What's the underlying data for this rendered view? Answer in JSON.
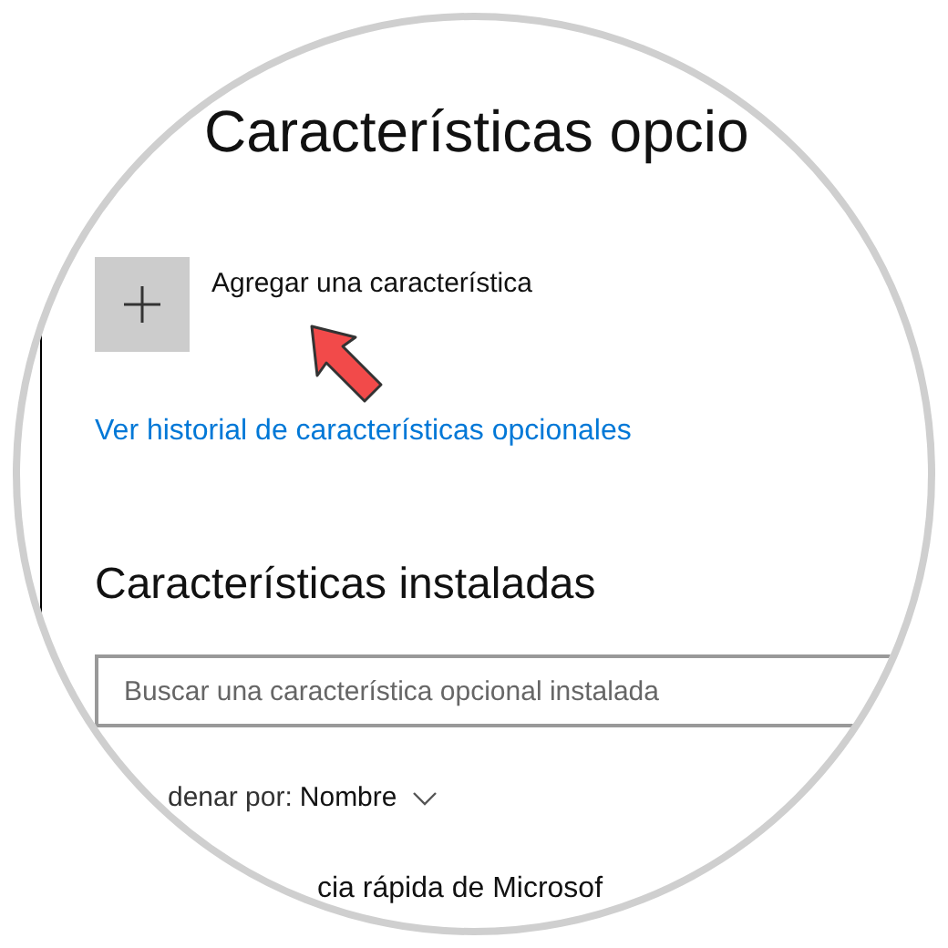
{
  "title": "Características opcio",
  "add_feature": {
    "label": "Agregar una característica"
  },
  "history_link": "Ver historial de características opcionales",
  "installed": {
    "heading": "Características instaladas",
    "search": {
      "placeholder": "Buscar una característica opcional instalada"
    },
    "sort": {
      "label": "denar por:",
      "value": "Nombre"
    },
    "items": [
      "cia rápida de Microsof"
    ]
  }
}
